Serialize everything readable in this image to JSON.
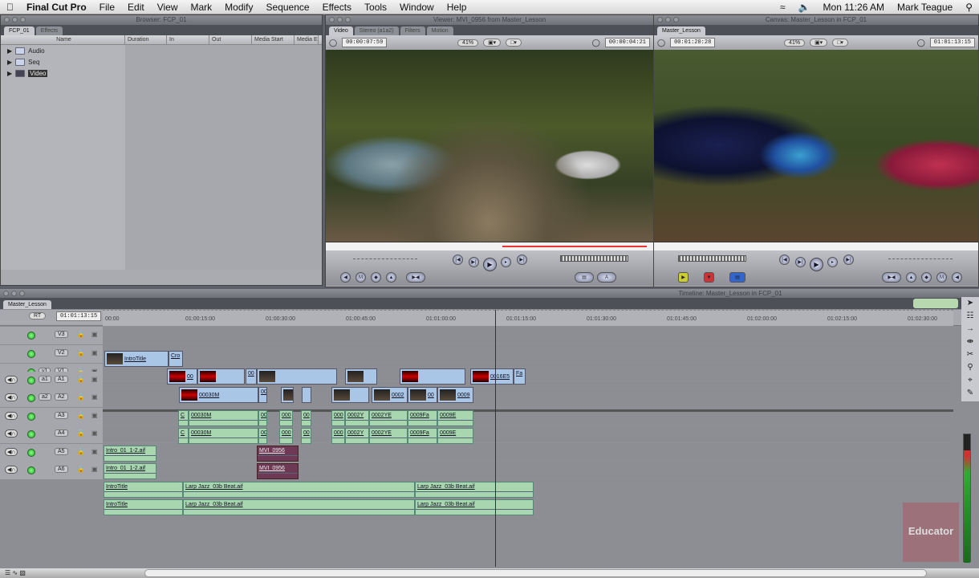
{
  "menubar": {
    "app": "Final Cut Pro",
    "items": [
      "File",
      "Edit",
      "View",
      "Mark",
      "Modify",
      "Sequence",
      "Effects",
      "Tools",
      "Window",
      "Help"
    ],
    "clock": "Mon 11:26 AM",
    "user": "Mark Teague"
  },
  "browser": {
    "title": "Browser: FCP_01",
    "tabs": [
      "FCP_01",
      "Effects"
    ],
    "columns": [
      "Name",
      "Duration",
      "In",
      "Out",
      "Media Start",
      "Media E"
    ],
    "items": [
      "Audio",
      "Seq",
      "Video"
    ]
  },
  "viewer": {
    "title": "Viewer: MVI_0956 from Master_Lesson",
    "tabs": [
      "Video",
      "Stereo (a1a2)",
      "Filters",
      "Motion"
    ],
    "duration": "00:00:07:59",
    "zoom": "41%",
    "timecode": "00:00:04:21"
  },
  "canvas": {
    "title": "Canvas: Master_Lesson in FCP_01",
    "tabs": [
      "Master_Lesson"
    ],
    "duration": "00:01:20:28",
    "zoom": "41%",
    "timecode": "01:01:13:15"
  },
  "timeline": {
    "title": "Timeline: Master_Lesson in FCP_01",
    "tab": "Master_Lesson",
    "rt": "RT",
    "timecode": "01:01:13:15",
    "ruler": [
      "00:00",
      "01:00:15:00",
      "01:00:30:00",
      "01:00:45:00",
      "01:01:00:00",
      "01:01:15:00",
      "01:01:30:00",
      "01:01:45:00",
      "01:02:00:00",
      "01:02:15:00",
      "01:02:30:00"
    ],
    "video_tracks": [
      {
        "src": "",
        "dst": "V3"
      },
      {
        "src": "",
        "dst": "V2"
      },
      {
        "src": "v1",
        "dst": "V1"
      }
    ],
    "audio_tracks": [
      {
        "src": "a1",
        "dst": "A1"
      },
      {
        "src": "a2",
        "dst": "A2"
      },
      {
        "src": "",
        "dst": "A3"
      },
      {
        "src": "",
        "dst": "A4"
      },
      {
        "src": "",
        "dst": "A5"
      },
      {
        "src": "",
        "dst": "A6"
      }
    ],
    "clips": {
      "intro_title": "IntroTitle",
      "cro": "Cro",
      "v2a": "00",
      "v2b": "00",
      "v2c": "0016E5",
      "v2d": "Fa",
      "v1a": "00030M",
      "v1b": "00",
      "v1c": "0002",
      "v1d": "00",
      "v1e": "0009",
      "a_c": "C",
      "a1": "00030M",
      "a2": "00",
      "a3": "000",
      "a4": "00",
      "a5": "000",
      "a6": "0002Y",
      "a7": "0002YE",
      "a8": "0009Fa",
      "a9": "0009E",
      "intro_aif": "Intro_01_1-2.aif",
      "mvi": "MVI_0956",
      "introtitle_a": "IntroTitle",
      "larp1": "Larp Jazz_03b Beat.aif",
      "larp2": "Larp Jazz_03b Beat.aif"
    }
  },
  "watermark": "Educator"
}
